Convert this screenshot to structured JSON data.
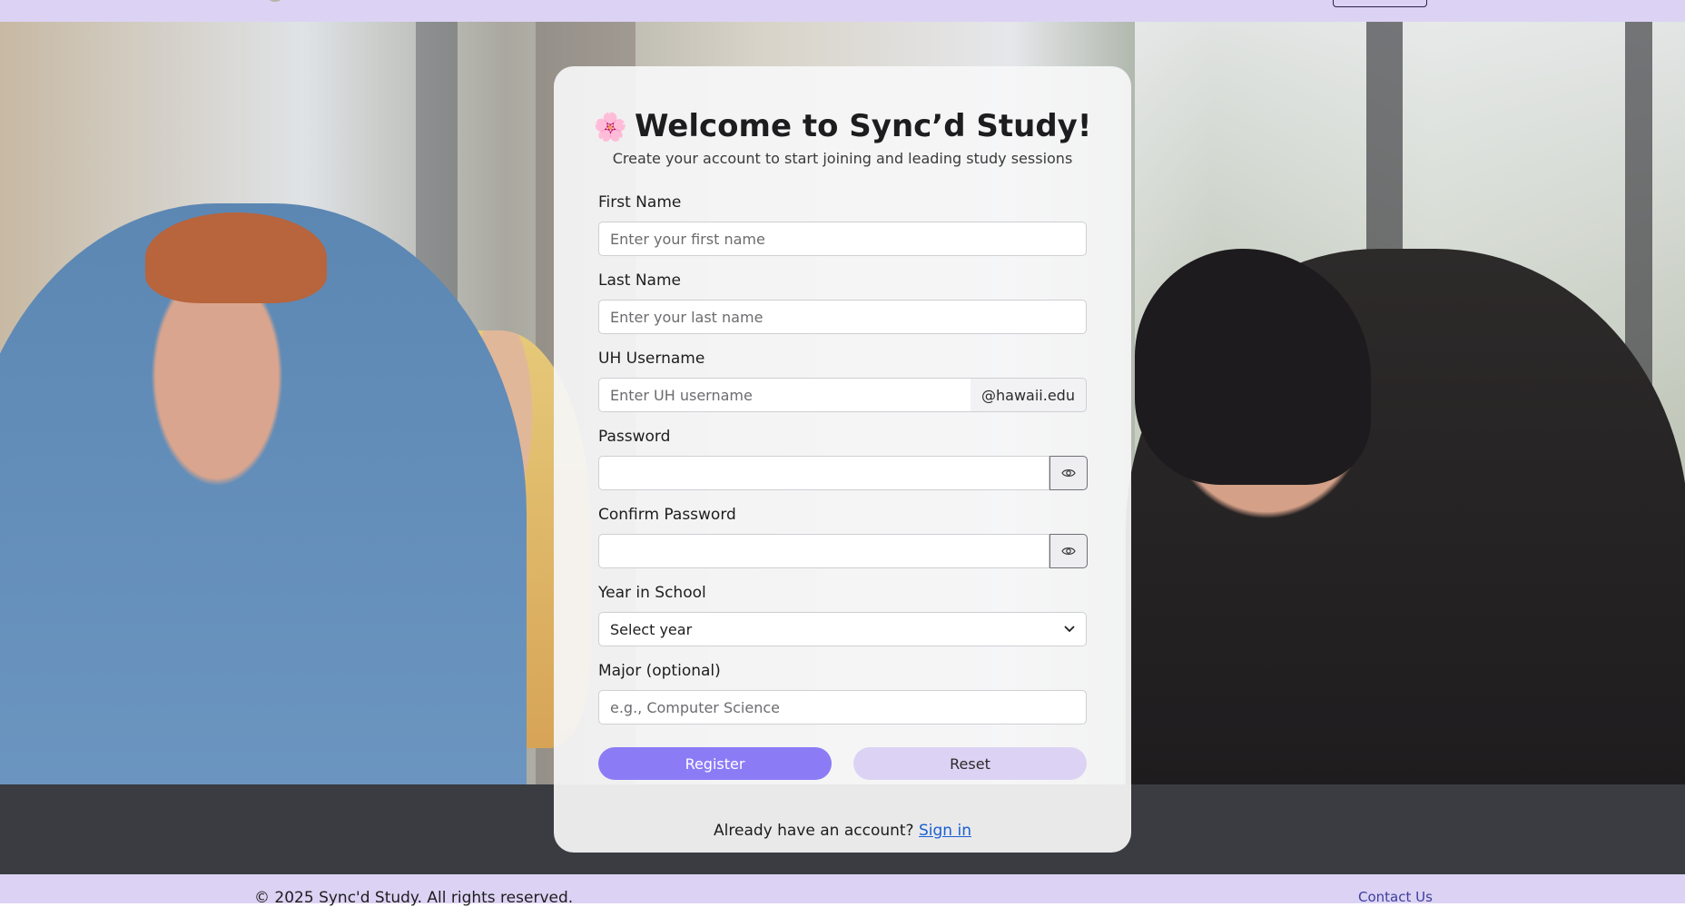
{
  "colors": {
    "nav_bg": "#dcd3f4",
    "primary_button": "#8b7cf6",
    "secondary_button": "#dcd3f4",
    "link": "#1a5fd1"
  },
  "card": {
    "emoji": "🌸",
    "title": "Welcome to Sync’d Study!",
    "subtitle": "Create your account to start joining and leading study sessions"
  },
  "form": {
    "first_name": {
      "label": "First Name",
      "placeholder": "Enter your first name",
      "value": ""
    },
    "last_name": {
      "label": "Last Name",
      "placeholder": "Enter your last name",
      "value": ""
    },
    "username": {
      "label": "UH Username",
      "placeholder": "Enter UH username",
      "suffix": "@hawaii.edu",
      "value": ""
    },
    "password": {
      "label": "Password",
      "value": "",
      "toggle_icon": "eye-icon"
    },
    "confirm_password": {
      "label": "Confirm Password",
      "value": "",
      "toggle_icon": "eye-icon"
    },
    "year": {
      "label": "Year in School",
      "selected": "Select year",
      "icon": "chevron-down-icon"
    },
    "major": {
      "label": "Major (optional)",
      "placeholder": "e.g., Computer Science",
      "value": ""
    },
    "register_label": "Register",
    "reset_label": "Reset"
  },
  "signin": {
    "prompt": "Already have an account?",
    "link_label": "Sign in"
  },
  "footer": {
    "copyright": "© 2025 Sync'd Study. All rights reserved.",
    "contact_label": "Contact Us"
  }
}
